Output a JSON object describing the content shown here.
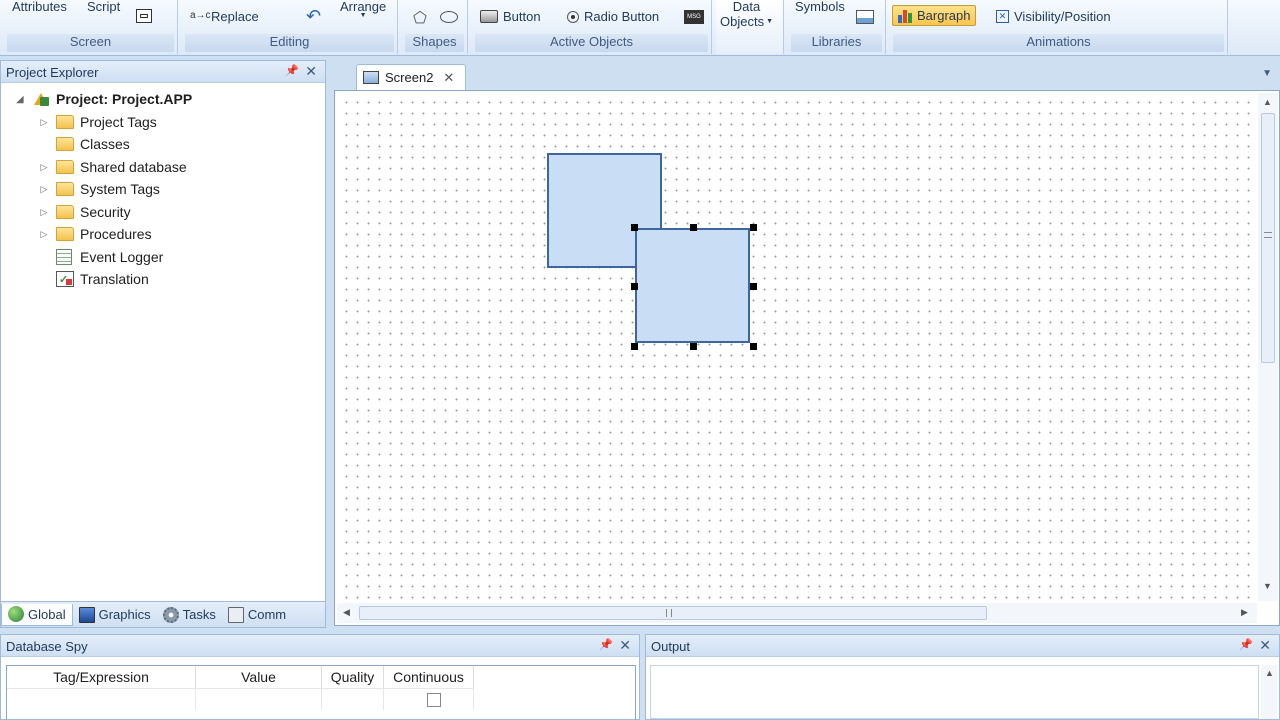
{
  "ribbon": {
    "screen": {
      "attributes": "Attributes",
      "script": "Script",
      "label": "Screen"
    },
    "editing": {
      "replace": "Replace",
      "arrange": "Arrange",
      "label": "Editing"
    },
    "shapes": {
      "label": "Shapes"
    },
    "active_objects": {
      "button": "Button",
      "radio_button": "Radio Button",
      "label": "Active Objects"
    },
    "data_objects": {
      "line1": "Data",
      "line2": "Objects"
    },
    "libraries": {
      "symbols": "Symbols",
      "label": "Libraries"
    },
    "animations": {
      "bargraph": "Bargraph",
      "visibility": "Visibility/Position",
      "label": "Animations"
    }
  },
  "explorer": {
    "title": "Project Explorer",
    "root": "Project: Project.APP",
    "items": [
      {
        "label": "Project Tags"
      },
      {
        "label": "Classes"
      },
      {
        "label": "Shared database"
      },
      {
        "label": "System Tags"
      },
      {
        "label": "Security"
      },
      {
        "label": "Procedures"
      },
      {
        "label": "Event Logger"
      },
      {
        "label": "Translation"
      }
    ],
    "tabs": [
      {
        "label": "Global"
      },
      {
        "label": "Graphics"
      },
      {
        "label": "Tasks"
      },
      {
        "label": "Comm"
      }
    ]
  },
  "document": {
    "tab": "Screen2"
  },
  "dbspy": {
    "title": "Database Spy",
    "columns": [
      "Tag/Expression",
      "Value",
      "Quality",
      "Continuous"
    ]
  },
  "output": {
    "title": "Output"
  }
}
